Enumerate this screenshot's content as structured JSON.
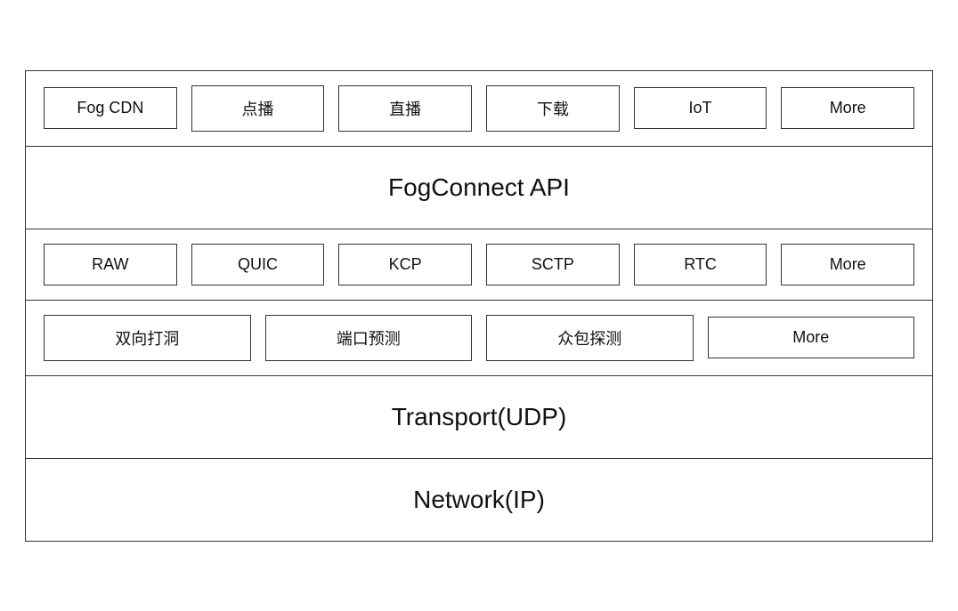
{
  "diagram": {
    "row1": {
      "items": [
        "Fog CDN",
        "点播",
        "直播",
        "下载",
        "IoT",
        "More"
      ]
    },
    "row2": {
      "label": "FogConnect API"
    },
    "row3": {
      "items": [
        "RAW",
        "QUIC",
        "KCP",
        "SCTP",
        "RTC",
        "More"
      ]
    },
    "row4": {
      "items": [
        "双向打洞",
        "端口预测",
        "众包探测",
        "More"
      ]
    },
    "row5": {
      "label": "Transport(UDP)"
    },
    "row6": {
      "label": "Network(IP)"
    }
  }
}
